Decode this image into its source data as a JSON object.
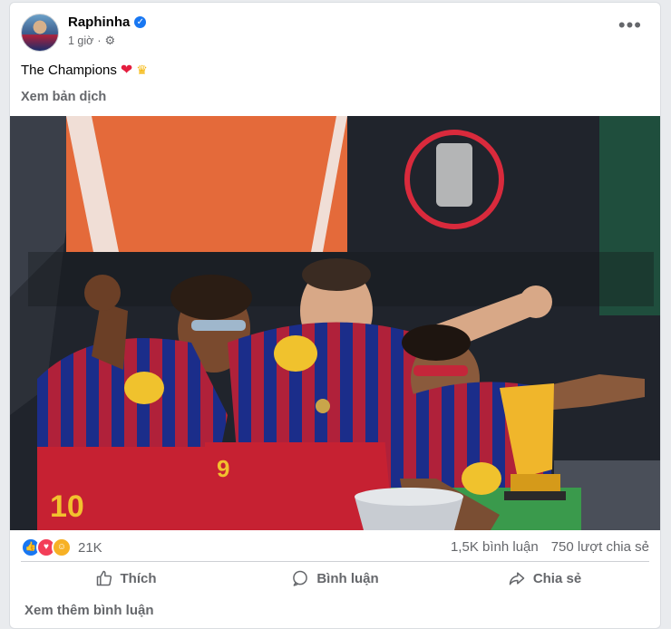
{
  "post": {
    "author": "Raphinha",
    "time": "1 giờ",
    "dot": "·",
    "caption": "The Champions",
    "caption_emojis": [
      "red-heart",
      "crown"
    ],
    "see_translation": "Xem bản dịch",
    "more_options": "•••"
  },
  "photo": {
    "jersey_number_left": "10",
    "jersey_number_middle": "9"
  },
  "stats": {
    "reaction_count": "21K",
    "comments": "1,5K bình luận",
    "shares": "750 lượt chia sẻ"
  },
  "actions": {
    "like": "Thích",
    "comment": "Bình luận",
    "share": "Chia sẻ"
  },
  "footer": {
    "more_comments": "Xem thêm bình luận"
  },
  "colors": {
    "fb_blue": "#1877f2",
    "love_red": "#f33e58",
    "barca_red": "#b0213a",
    "barca_blue": "#1b2d8a",
    "gold": "#f0b62b"
  }
}
